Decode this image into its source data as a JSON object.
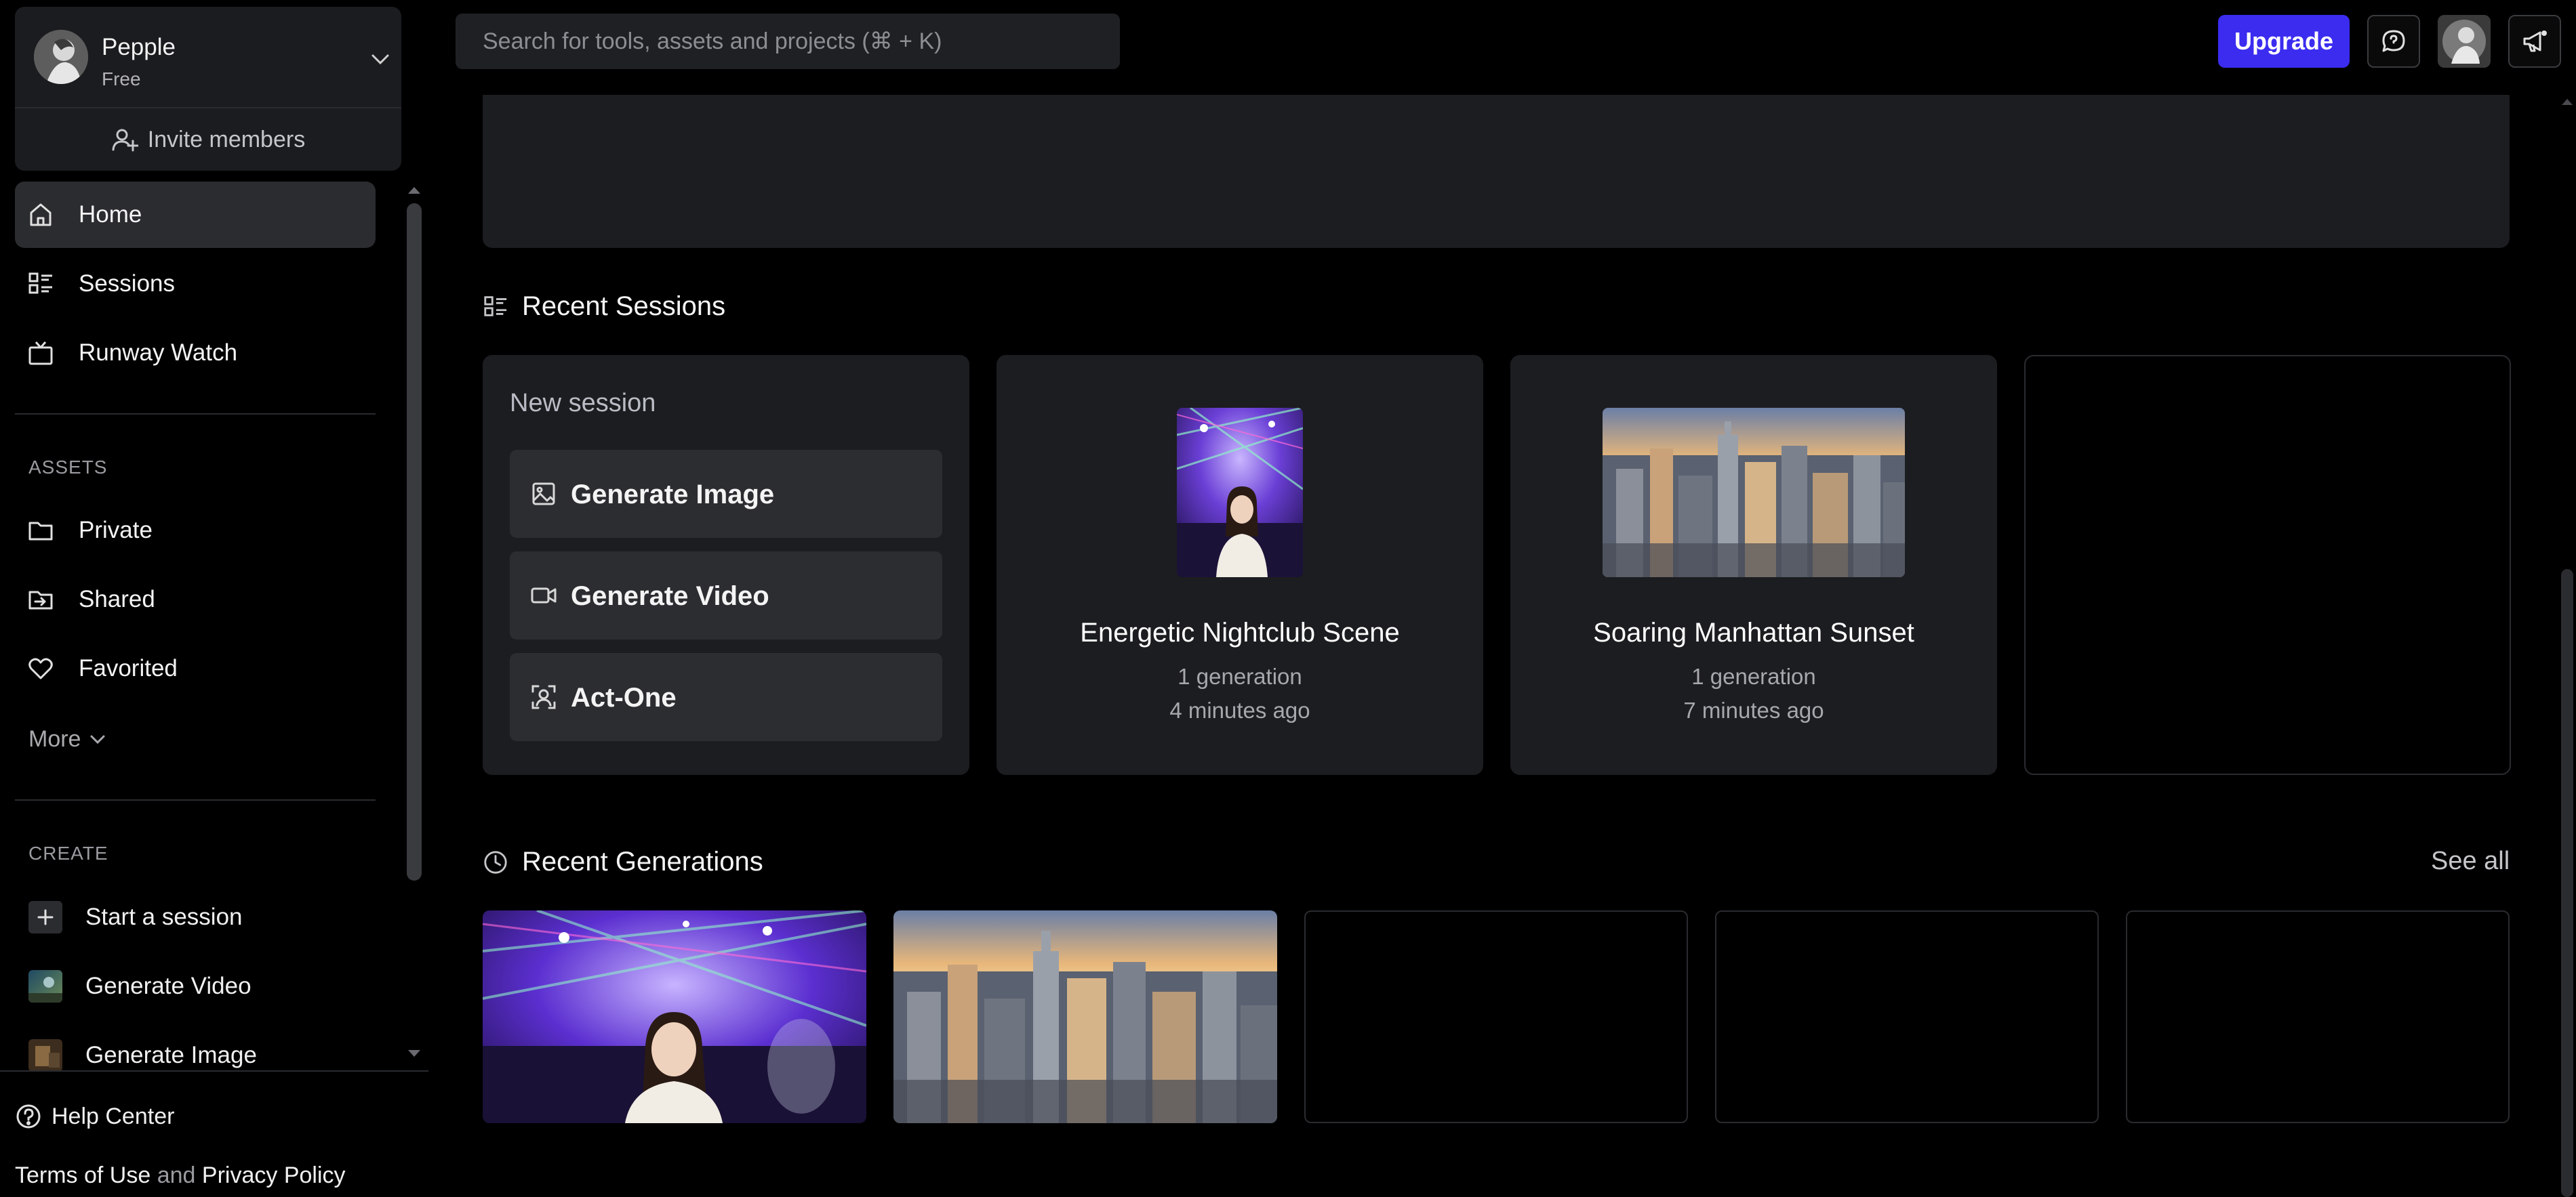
{
  "workspace": {
    "name": "Pepple",
    "plan": "Free",
    "invite_label": "Invite members"
  },
  "sidebar": {
    "nav": [
      {
        "label": "Home",
        "icon": "home-icon",
        "active": true
      },
      {
        "label": "Sessions",
        "icon": "sessions-icon"
      },
      {
        "label": "Runway Watch",
        "icon": "tv-icon"
      }
    ],
    "assets_heading": "ASSETS",
    "assets": [
      {
        "label": "Private",
        "icon": "folder-icon"
      },
      {
        "label": "Shared",
        "icon": "shared-folder-icon"
      },
      {
        "label": "Favorited",
        "icon": "heart-icon"
      }
    ],
    "more_label": "More",
    "create_heading": "CREATE",
    "create": [
      {
        "label": "Start a session",
        "icon": "plus-icon"
      },
      {
        "label": "Generate Video",
        "icon": "video-thumbnail"
      },
      {
        "label": "Generate Image",
        "icon": "image-thumbnail"
      }
    ],
    "help_label": "Help Center",
    "terms_label": "Terms of Use",
    "and_label": "and",
    "privacy_label": "Privacy Policy"
  },
  "search": {
    "placeholder": "Search for tools, assets and projects (⌘ + K)"
  },
  "header": {
    "upgrade_label": "Upgrade"
  },
  "recent_sessions": {
    "title": "Recent Sessions",
    "new_session": {
      "title": "New session",
      "buttons": [
        {
          "label": "Generate Image",
          "icon": "image-icon"
        },
        {
          "label": "Generate Video",
          "icon": "video-icon"
        },
        {
          "label": "Act-One",
          "icon": "face-scan-icon"
        }
      ]
    },
    "sessions": [
      {
        "title": "Energetic Nightclub Scene",
        "generations": "1 generation",
        "time": "4 minutes ago"
      },
      {
        "title": "Soaring Manhattan Sunset",
        "generations": "1 generation",
        "time": "7 minutes ago"
      }
    ]
  },
  "recent_generations": {
    "title": "Recent Generations",
    "see_all_label": "See all"
  },
  "colors": {
    "accent": "#3b2cf0",
    "panel": "#1c1d20",
    "background": "#000000"
  }
}
